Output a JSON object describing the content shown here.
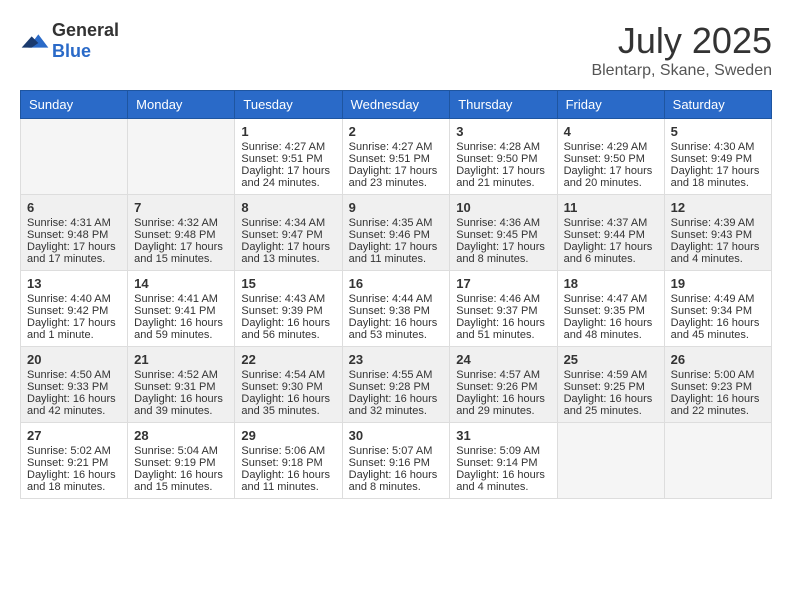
{
  "header": {
    "logo_general": "General",
    "logo_blue": "Blue",
    "month": "July 2025",
    "location": "Blentarp, Skane, Sweden"
  },
  "days_of_week": [
    "Sunday",
    "Monday",
    "Tuesday",
    "Wednesday",
    "Thursday",
    "Friday",
    "Saturday"
  ],
  "weeks": [
    [
      {
        "day": "",
        "info": ""
      },
      {
        "day": "",
        "info": ""
      },
      {
        "day": "1",
        "sunrise": "Sunrise: 4:27 AM",
        "sunset": "Sunset: 9:51 PM",
        "daylight": "Daylight: 17 hours and 24 minutes."
      },
      {
        "day": "2",
        "sunrise": "Sunrise: 4:27 AM",
        "sunset": "Sunset: 9:51 PM",
        "daylight": "Daylight: 17 hours and 23 minutes."
      },
      {
        "day": "3",
        "sunrise": "Sunrise: 4:28 AM",
        "sunset": "Sunset: 9:50 PM",
        "daylight": "Daylight: 17 hours and 21 minutes."
      },
      {
        "day": "4",
        "sunrise": "Sunrise: 4:29 AM",
        "sunset": "Sunset: 9:50 PM",
        "daylight": "Daylight: 17 hours and 20 minutes."
      },
      {
        "day": "5",
        "sunrise": "Sunrise: 4:30 AM",
        "sunset": "Sunset: 9:49 PM",
        "daylight": "Daylight: 17 hours and 18 minutes."
      }
    ],
    [
      {
        "day": "6",
        "sunrise": "Sunrise: 4:31 AM",
        "sunset": "Sunset: 9:48 PM",
        "daylight": "Daylight: 17 hours and 17 minutes."
      },
      {
        "day": "7",
        "sunrise": "Sunrise: 4:32 AM",
        "sunset": "Sunset: 9:48 PM",
        "daylight": "Daylight: 17 hours and 15 minutes."
      },
      {
        "day": "8",
        "sunrise": "Sunrise: 4:34 AM",
        "sunset": "Sunset: 9:47 PM",
        "daylight": "Daylight: 17 hours and 13 minutes."
      },
      {
        "day": "9",
        "sunrise": "Sunrise: 4:35 AM",
        "sunset": "Sunset: 9:46 PM",
        "daylight": "Daylight: 17 hours and 11 minutes."
      },
      {
        "day": "10",
        "sunrise": "Sunrise: 4:36 AM",
        "sunset": "Sunset: 9:45 PM",
        "daylight": "Daylight: 17 hours and 8 minutes."
      },
      {
        "day": "11",
        "sunrise": "Sunrise: 4:37 AM",
        "sunset": "Sunset: 9:44 PM",
        "daylight": "Daylight: 17 hours and 6 minutes."
      },
      {
        "day": "12",
        "sunrise": "Sunrise: 4:39 AM",
        "sunset": "Sunset: 9:43 PM",
        "daylight": "Daylight: 17 hours and 4 minutes."
      }
    ],
    [
      {
        "day": "13",
        "sunrise": "Sunrise: 4:40 AM",
        "sunset": "Sunset: 9:42 PM",
        "daylight": "Daylight: 17 hours and 1 minute."
      },
      {
        "day": "14",
        "sunrise": "Sunrise: 4:41 AM",
        "sunset": "Sunset: 9:41 PM",
        "daylight": "Daylight: 16 hours and 59 minutes."
      },
      {
        "day": "15",
        "sunrise": "Sunrise: 4:43 AM",
        "sunset": "Sunset: 9:39 PM",
        "daylight": "Daylight: 16 hours and 56 minutes."
      },
      {
        "day": "16",
        "sunrise": "Sunrise: 4:44 AM",
        "sunset": "Sunset: 9:38 PM",
        "daylight": "Daylight: 16 hours and 53 minutes."
      },
      {
        "day": "17",
        "sunrise": "Sunrise: 4:46 AM",
        "sunset": "Sunset: 9:37 PM",
        "daylight": "Daylight: 16 hours and 51 minutes."
      },
      {
        "day": "18",
        "sunrise": "Sunrise: 4:47 AM",
        "sunset": "Sunset: 9:35 PM",
        "daylight": "Daylight: 16 hours and 48 minutes."
      },
      {
        "day": "19",
        "sunrise": "Sunrise: 4:49 AM",
        "sunset": "Sunset: 9:34 PM",
        "daylight": "Daylight: 16 hours and 45 minutes."
      }
    ],
    [
      {
        "day": "20",
        "sunrise": "Sunrise: 4:50 AM",
        "sunset": "Sunset: 9:33 PM",
        "daylight": "Daylight: 16 hours and 42 minutes."
      },
      {
        "day": "21",
        "sunrise": "Sunrise: 4:52 AM",
        "sunset": "Sunset: 9:31 PM",
        "daylight": "Daylight: 16 hours and 39 minutes."
      },
      {
        "day": "22",
        "sunrise": "Sunrise: 4:54 AM",
        "sunset": "Sunset: 9:30 PM",
        "daylight": "Daylight: 16 hours and 35 minutes."
      },
      {
        "day": "23",
        "sunrise": "Sunrise: 4:55 AM",
        "sunset": "Sunset: 9:28 PM",
        "daylight": "Daylight: 16 hours and 32 minutes."
      },
      {
        "day": "24",
        "sunrise": "Sunrise: 4:57 AM",
        "sunset": "Sunset: 9:26 PM",
        "daylight": "Daylight: 16 hours and 29 minutes."
      },
      {
        "day": "25",
        "sunrise": "Sunrise: 4:59 AM",
        "sunset": "Sunset: 9:25 PM",
        "daylight": "Daylight: 16 hours and 25 minutes."
      },
      {
        "day": "26",
        "sunrise": "Sunrise: 5:00 AM",
        "sunset": "Sunset: 9:23 PM",
        "daylight": "Daylight: 16 hours and 22 minutes."
      }
    ],
    [
      {
        "day": "27",
        "sunrise": "Sunrise: 5:02 AM",
        "sunset": "Sunset: 9:21 PM",
        "daylight": "Daylight: 16 hours and 18 minutes."
      },
      {
        "day": "28",
        "sunrise": "Sunrise: 5:04 AM",
        "sunset": "Sunset: 9:19 PM",
        "daylight": "Daylight: 16 hours and 15 minutes."
      },
      {
        "day": "29",
        "sunrise": "Sunrise: 5:06 AM",
        "sunset": "Sunset: 9:18 PM",
        "daylight": "Daylight: 16 hours and 11 minutes."
      },
      {
        "day": "30",
        "sunrise": "Sunrise: 5:07 AM",
        "sunset": "Sunset: 9:16 PM",
        "daylight": "Daylight: 16 hours and 8 minutes."
      },
      {
        "day": "31",
        "sunrise": "Sunrise: 5:09 AM",
        "sunset": "Sunset: 9:14 PM",
        "daylight": "Daylight: 16 hours and 4 minutes."
      },
      {
        "day": "",
        "info": ""
      },
      {
        "day": "",
        "info": ""
      }
    ]
  ]
}
